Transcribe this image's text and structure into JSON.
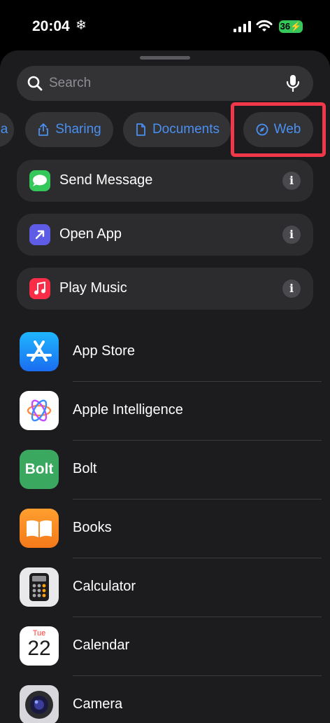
{
  "status": {
    "time": "20:04",
    "battery": "36"
  },
  "search": {
    "placeholder": "Search"
  },
  "chips": [
    {
      "label": "a"
    },
    {
      "label": "Sharing"
    },
    {
      "label": "Documents"
    },
    {
      "label": "Web"
    }
  ],
  "actions": [
    {
      "label": "Send Message",
      "icon": "message-icon",
      "color": "#34c759"
    },
    {
      "label": "Open App",
      "icon": "open-app-icon",
      "color": "#5e5ce6"
    },
    {
      "label": "Play Music",
      "icon": "music-icon",
      "color": "#fa2d48"
    }
  ],
  "apps": [
    {
      "name": "App Store",
      "icon": "app-store-icon"
    },
    {
      "name": "Apple Intelligence",
      "icon": "apple-intelligence-icon"
    },
    {
      "name": "Bolt",
      "icon": "bolt-icon",
      "icon_text": "Bolt"
    },
    {
      "name": "Books",
      "icon": "books-icon"
    },
    {
      "name": "Calculator",
      "icon": "calculator-icon"
    },
    {
      "name": "Calendar",
      "icon": "calendar-icon",
      "day": "Tue",
      "date": "22"
    },
    {
      "name": "Camera",
      "icon": "camera-icon"
    }
  ],
  "colors": {
    "accent": "#4a90f0",
    "highlight": "#f0384a"
  }
}
